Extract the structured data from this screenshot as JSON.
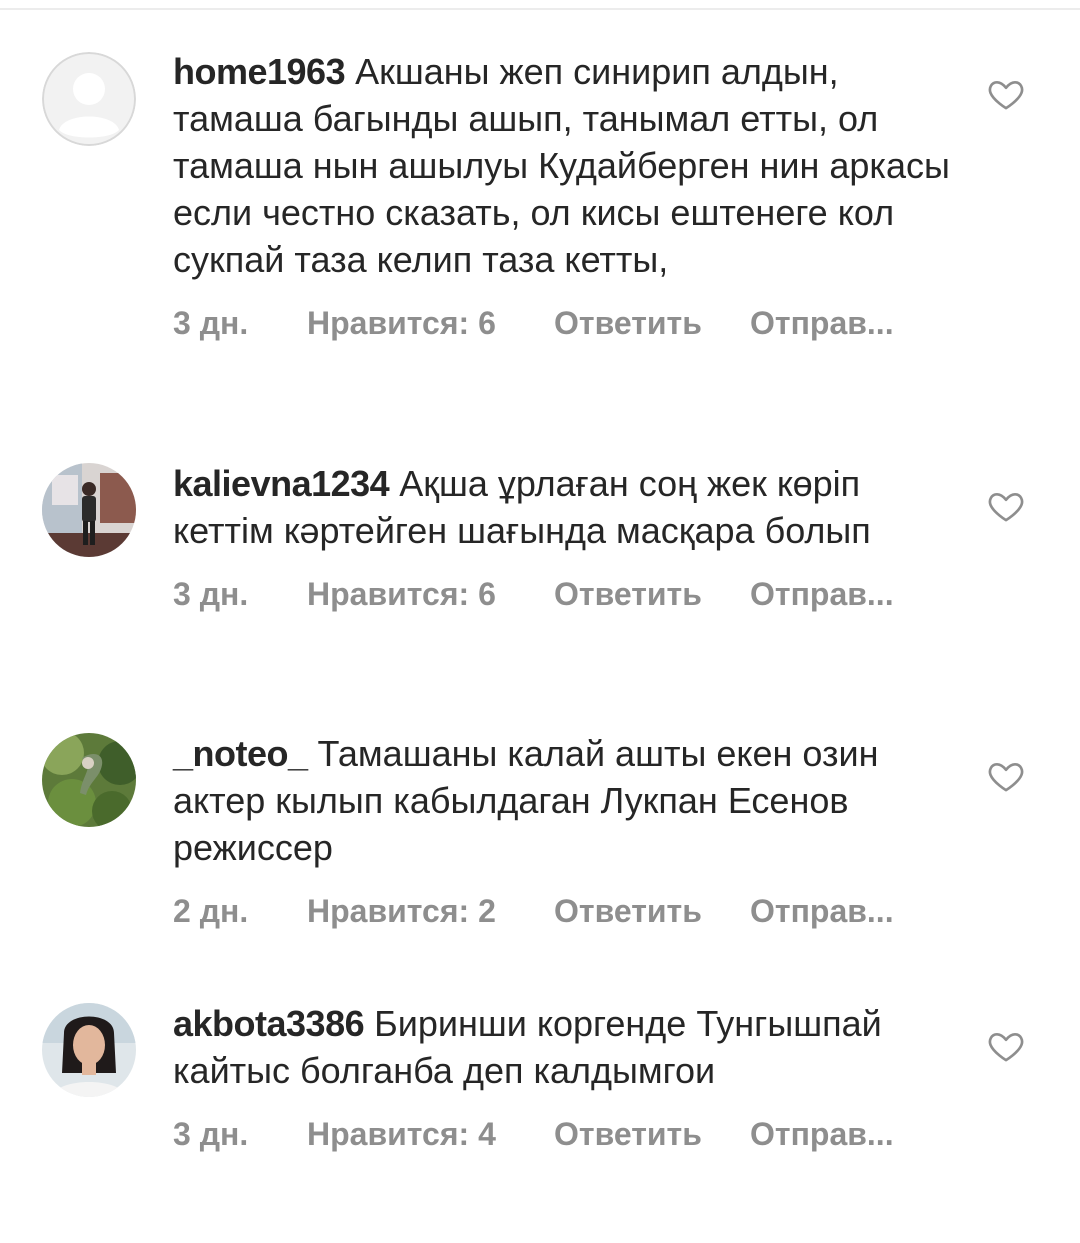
{
  "comments": [
    {
      "username": "home1963",
      "text": "Акшаны жеп синирип алдын, тамаша багынды ашып, танымал етты, ол тамаша нын ашылуы Кудайберген нин аркасы если честно сказать, ол кисы ештенеге кол сукпай таза келип таза кетты,",
      "time": "3 дн.",
      "likes": "Нравится: 6",
      "reply": "Ответить",
      "send": "Отправ..."
    },
    {
      "username": "kalievna1234",
      "text": "Ақша ұрлаған соң жек көріп кеттім кәртейген шағында масқара болып",
      "time": "3 дн.",
      "likes": "Нравится: 6",
      "reply": "Ответить",
      "send": "Отправ..."
    },
    {
      "username": "_noteo_",
      "text": "Тамашаны калай ашты екен озин актер кылып кабылдаган Лукпан Есенов режиссер",
      "time": "2 дн.",
      "likes": "Нравится: 2",
      "reply": "Ответить",
      "send": "Отправ..."
    },
    {
      "username": "akbota3386",
      "text": "Биринши коргенде Тунгышпай кайтыс болганба деп калдымгои",
      "time": "3 дн.",
      "likes": "Нравится: 4",
      "reply": "Ответить",
      "send": "Отправ..."
    }
  ]
}
